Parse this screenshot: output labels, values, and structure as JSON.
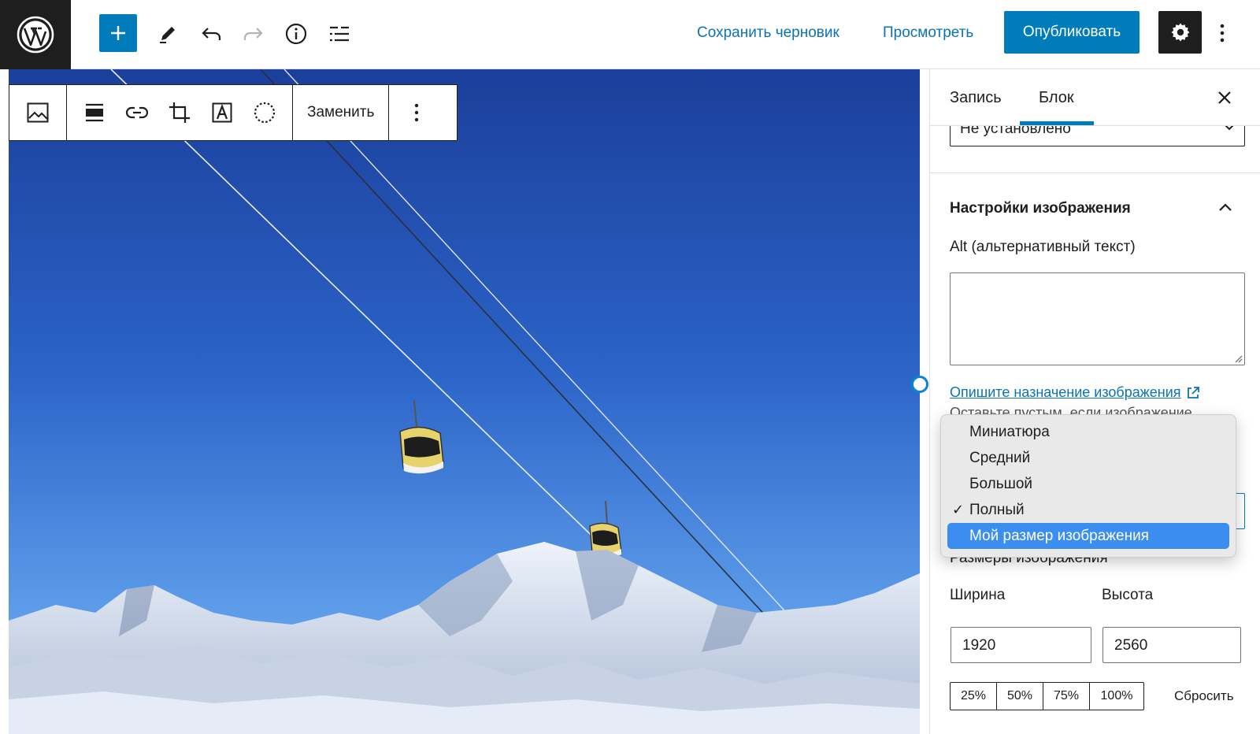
{
  "topbar": {
    "logo": "wordpress-logo",
    "save_draft": "Сохранить черновик",
    "preview": "Просмотреть",
    "publish": "Опубликовать",
    "accent": "#007cba"
  },
  "block_toolbar": {
    "replace": "Заменить"
  },
  "sidebar": {
    "tabs": [
      {
        "label": "Запись"
      },
      {
        "label": "Блок"
      }
    ],
    "link_target_value": "Не установлено",
    "image_settings_title": "Настройки изображения",
    "alt_label": "Alt (альтернативный текст)",
    "alt_value": "",
    "alt_help_link": "Опишите назначение изображения",
    "alt_help_note": "Оставьте пустым, если изображение",
    "image_dimensions_label": "Размеры изображения",
    "width_label": "Ширина",
    "height_label": "Высота",
    "width_value": "1920",
    "height_value": "2560",
    "percentages": [
      "25%",
      "50%",
      "75%",
      "100%"
    ],
    "reset": "Сбросить"
  },
  "size_dropdown": {
    "items": [
      {
        "label": "Миниатюра",
        "checked": false,
        "highlighted": false
      },
      {
        "label": "Средний",
        "checked": false,
        "highlighted": false
      },
      {
        "label": "Большой",
        "checked": false,
        "highlighted": false
      },
      {
        "label": "Полный",
        "checked": true,
        "highlighted": false
      },
      {
        "label": "Мой размер изображения",
        "checked": false,
        "highlighted": true
      }
    ],
    "check_mark": "✓",
    "highlight_color": "#3b8ef0"
  }
}
